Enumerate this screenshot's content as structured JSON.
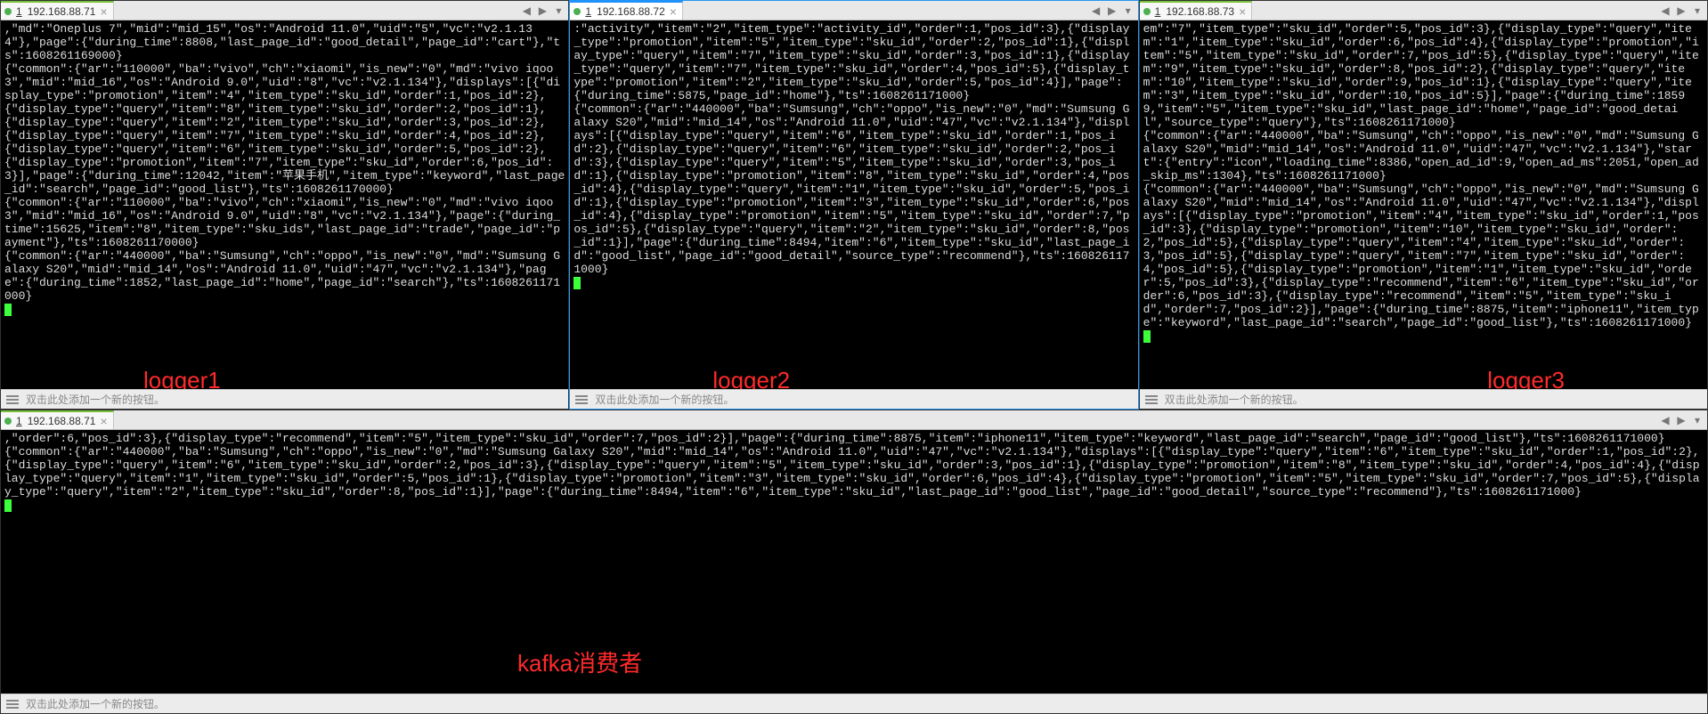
{
  "pane1": {
    "tab_index": "1",
    "tab_title": "192.168.88.71",
    "red_label": "logger1",
    "footer": "双击此处添加一个新的按钮。",
    "content": ",\"md\":\"Oneplus 7\",\"mid\":\"mid_15\",\"os\":\"Android 11.0\",\"uid\":\"5\",\"vc\":\"v2.1.134\"},\"page\":{\"during_time\":8808,\"last_page_id\":\"good_detail\",\"page_id\":\"cart\"},\"ts\":1608261169000}\n{\"common\":{\"ar\":\"110000\",\"ba\":\"vivo\",\"ch\":\"xiaomi\",\"is_new\":\"0\",\"md\":\"vivo iqoo3\",\"mid\":\"mid_16\",\"os\":\"Android 9.0\",\"uid\":\"8\",\"vc\":\"v2.1.134\"},\"displays\":[{\"display_type\":\"promotion\",\"item\":\"4\",\"item_type\":\"sku_id\",\"order\":1,\"pos_id\":2},{\"display_type\":\"query\",\"item\":\"8\",\"item_type\":\"sku_id\",\"order\":2,\"pos_id\":1},{\"display_type\":\"query\",\"item\":\"2\",\"item_type\":\"sku_id\",\"order\":3,\"pos_id\":2},{\"display_type\":\"query\",\"item\":\"7\",\"item_type\":\"sku_id\",\"order\":4,\"pos_id\":2},{\"display_type\":\"query\",\"item\":\"6\",\"item_type\":\"sku_id\",\"order\":5,\"pos_id\":2},{\"display_type\":\"promotion\",\"item\":\"7\",\"item_type\":\"sku_id\",\"order\":6,\"pos_id\":3}],\"page\":{\"during_time\":12042,\"item\":\"苹果手机\",\"item_type\":\"keyword\",\"last_page_id\":\"search\",\"page_id\":\"good_list\"},\"ts\":1608261170000}\n{\"common\":{\"ar\":\"110000\",\"ba\":\"vivo\",\"ch\":\"xiaomi\",\"is_new\":\"0\",\"md\":\"vivo iqoo3\",\"mid\":\"mid_16\",\"os\":\"Android 9.0\",\"uid\":\"8\",\"vc\":\"v2.1.134\"},\"page\":{\"during_time\":15625,\"item\":\"8\",\"item_type\":\"sku_ids\",\"last_page_id\":\"trade\",\"page_id\":\"payment\"},\"ts\":1608261170000}\n{\"common\":{\"ar\":\"440000\",\"ba\":\"Sumsung\",\"ch\":\"oppo\",\"is_new\":\"0\",\"md\":\"Sumsung Galaxy S20\",\"mid\":\"mid_14\",\"os\":\"Android 11.0\",\"uid\":\"47\",\"vc\":\"v2.1.134\"},\"page\":{\"during_time\":1852,\"last_page_id\":\"home\",\"page_id\":\"search\"},\"ts\":1608261171000}"
  },
  "pane2": {
    "tab_index": "1",
    "tab_title": "192.168.88.72",
    "red_label": "logger2",
    "footer": "双击此处添加一个新的按钮。",
    "content": ":\"activity\",\"item\":\"2\",\"item_type\":\"activity_id\",\"order\":1,\"pos_id\":3},{\"display_type\":\"promotion\",\"item\":\"5\",\"item_type\":\"sku_id\",\"order\":2,\"pos_id\":1},{\"display_type\":\"query\",\"item\":\"7\",\"item_type\":\"sku_id\",\"order\":3,\"pos_id\":1},{\"display_type\":\"query\",\"item\":\"7\",\"item_type\":\"sku_id\",\"order\":4,\"pos_id\":5},{\"display_type\":\"promotion\",\"item\":\"2\",\"item_type\":\"sku_id\",\"order\":5,\"pos_id\":4}],\"page\":{\"during_time\":5875,\"page_id\":\"home\"},\"ts\":1608261171000}\n{\"common\":{\"ar\":\"440000\",\"ba\":\"Sumsung\",\"ch\":\"oppo\",\"is_new\":\"0\",\"md\":\"Sumsung Galaxy S20\",\"mid\":\"mid_14\",\"os\":\"Android 11.0\",\"uid\":\"47\",\"vc\":\"v2.1.134\"},\"displays\":[{\"display_type\":\"query\",\"item\":\"6\",\"item_type\":\"sku_id\",\"order\":1,\"pos_id\":2},{\"display_type\":\"query\",\"item\":\"6\",\"item_type\":\"sku_id\",\"order\":2,\"pos_id\":3},{\"display_type\":\"query\",\"item\":\"5\",\"item_type\":\"sku_id\",\"order\":3,\"pos_id\":1},{\"display_type\":\"promotion\",\"item\":\"8\",\"item_type\":\"sku_id\",\"order\":4,\"pos_id\":4},{\"display_type\":\"query\",\"item\":\"1\",\"item_type\":\"sku_id\",\"order\":5,\"pos_id\":1},{\"display_type\":\"promotion\",\"item\":\"3\",\"item_type\":\"sku_id\",\"order\":6,\"pos_id\":4},{\"display_type\":\"promotion\",\"item\":\"5\",\"item_type\":\"sku_id\",\"order\":7,\"pos_id\":5},{\"display_type\":\"query\",\"item\":\"2\",\"item_type\":\"sku_id\",\"order\":8,\"pos_id\":1}],\"page\":{\"during_time\":8494,\"item\":\"6\",\"item_type\":\"sku_id\",\"last_page_id\":\"good_list\",\"page_id\":\"good_detail\",\"source_type\":\"recommend\"},\"ts\":1608261171000}"
  },
  "pane3": {
    "tab_index": "1",
    "tab_title": "192.168.88.73",
    "red_label": "logger3",
    "footer": "双击此处添加一个新的按钮。",
    "content": "em\":\"7\",\"item_type\":\"sku_id\",\"order\":5,\"pos_id\":3},{\"display_type\":\"query\",\"item\":\"1\",\"item_type\":\"sku_id\",\"order\":6,\"pos_id\":4},{\"display_type\":\"promotion\",\"item\":\"5\",\"item_type\":\"sku_id\",\"order\":7,\"pos_id\":5},{\"display_type\":\"query\",\"item\":\"9\",\"item_type\":\"sku_id\",\"order\":8,\"pos_id\":2},{\"display_type\":\"query\",\"item\":\"10\",\"item_type\":\"sku_id\",\"order\":9,\"pos_id\":1},{\"display_type\":\"query\",\"item\":\"3\",\"item_type\":\"sku_id\",\"order\":10,\"pos_id\":5}],\"page\":{\"during_time\":18599,\"item\":\"5\",\"item_type\":\"sku_id\",\"last_page_id\":\"home\",\"page_id\":\"good_detail\",\"source_type\":\"query\"},\"ts\":1608261171000}\n{\"common\":{\"ar\":\"440000\",\"ba\":\"Sumsung\",\"ch\":\"oppo\",\"is_new\":\"0\",\"md\":\"Sumsung Galaxy S20\",\"mid\":\"mid_14\",\"os\":\"Android 11.0\",\"uid\":\"47\",\"vc\":\"v2.1.134\"},\"start\":{\"entry\":\"icon\",\"loading_time\":8386,\"open_ad_id\":9,\"open_ad_ms\":2051,\"open_ad_skip_ms\":1304},\"ts\":1608261171000}\n{\"common\":{\"ar\":\"440000\",\"ba\":\"Sumsung\",\"ch\":\"oppo\",\"is_new\":\"0\",\"md\":\"Sumsung Galaxy S20\",\"mid\":\"mid_14\",\"os\":\"Android 11.0\",\"uid\":\"47\",\"vc\":\"v2.1.134\"},\"displays\":[{\"display_type\":\"promotion\",\"item\":\"4\",\"item_type\":\"sku_id\",\"order\":1,\"pos_id\":3},{\"display_type\":\"promotion\",\"item\":\"10\",\"item_type\":\"sku_id\",\"order\":2,\"pos_id\":5},{\"display_type\":\"query\",\"item\":\"4\",\"item_type\":\"sku_id\",\"order\":3,\"pos_id\":5},{\"display_type\":\"query\",\"item\":\"7\",\"item_type\":\"sku_id\",\"order\":4,\"pos_id\":5},{\"display_type\":\"promotion\",\"item\":\"1\",\"item_type\":\"sku_id\",\"order\":5,\"pos_id\":3},{\"display_type\":\"recommend\",\"item\":\"6\",\"item_type\":\"sku_id\",\"order\":6,\"pos_id\":3},{\"display_type\":\"recommend\",\"item\":\"5\",\"item_type\":\"sku_id\",\"order\":7,\"pos_id\":2}],\"page\":{\"during_time\":8875,\"item\":\"iphone11\",\"item_type\":\"keyword\",\"last_page_id\":\"search\",\"page_id\":\"good_list\"},\"ts\":1608261171000}"
  },
  "pane4": {
    "tab_index": "1",
    "tab_title": "192.168.88.71",
    "red_label": "kafka消费者",
    "footer": "双击此处添加一个新的按钮。",
    "content": ",\"order\":6,\"pos_id\":3},{\"display_type\":\"recommend\",\"item\":\"5\",\"item_type\":\"sku_id\",\"order\":7,\"pos_id\":2}],\"page\":{\"during_time\":8875,\"item\":\"iphone11\",\"item_type\":\"keyword\",\"last_page_id\":\"search\",\"page_id\":\"good_list\"},\"ts\":1608261171000}\n{\"common\":{\"ar\":\"440000\",\"ba\":\"Sumsung\",\"ch\":\"oppo\",\"is_new\":\"0\",\"md\":\"Sumsung Galaxy S20\",\"mid\":\"mid_14\",\"os\":\"Android 11.0\",\"uid\":\"47\",\"vc\":\"v2.1.134\"},\"displays\":[{\"display_type\":\"query\",\"item\":\"6\",\"item_type\":\"sku_id\",\"order\":1,\"pos_id\":2},{\"display_type\":\"query\",\"item\":\"6\",\"item_type\":\"sku_id\",\"order\":2,\"pos_id\":3},{\"display_type\":\"query\",\"item\":\"5\",\"item_type\":\"sku_id\",\"order\":3,\"pos_id\":1},{\"display_type\":\"promotion\",\"item\":\"8\",\"item_type\":\"sku_id\",\"order\":4,\"pos_id\":4},{\"display_type\":\"query\",\"item\":\"1\",\"item_type\":\"sku_id\",\"order\":5,\"pos_id\":1},{\"display_type\":\"promotion\",\"item\":\"3\",\"item_type\":\"sku_id\",\"order\":6,\"pos_id\":4},{\"display_type\":\"promotion\",\"item\":\"5\",\"item_type\":\"sku_id\",\"order\":7,\"pos_id\":5},{\"display_type\":\"query\",\"item\":\"2\",\"item_type\":\"sku_id\",\"order\":8,\"pos_id\":1}],\"page\":{\"during_time\":8494,\"item\":\"6\",\"item_type\":\"sku_id\",\"last_page_id\":\"good_list\",\"page_id\":\"good_detail\",\"source_type\":\"recommend\"},\"ts\":1608261171000}"
  },
  "nav": {
    "prev": "◀",
    "next": "▶",
    "menu": "▾",
    "close": "×"
  }
}
